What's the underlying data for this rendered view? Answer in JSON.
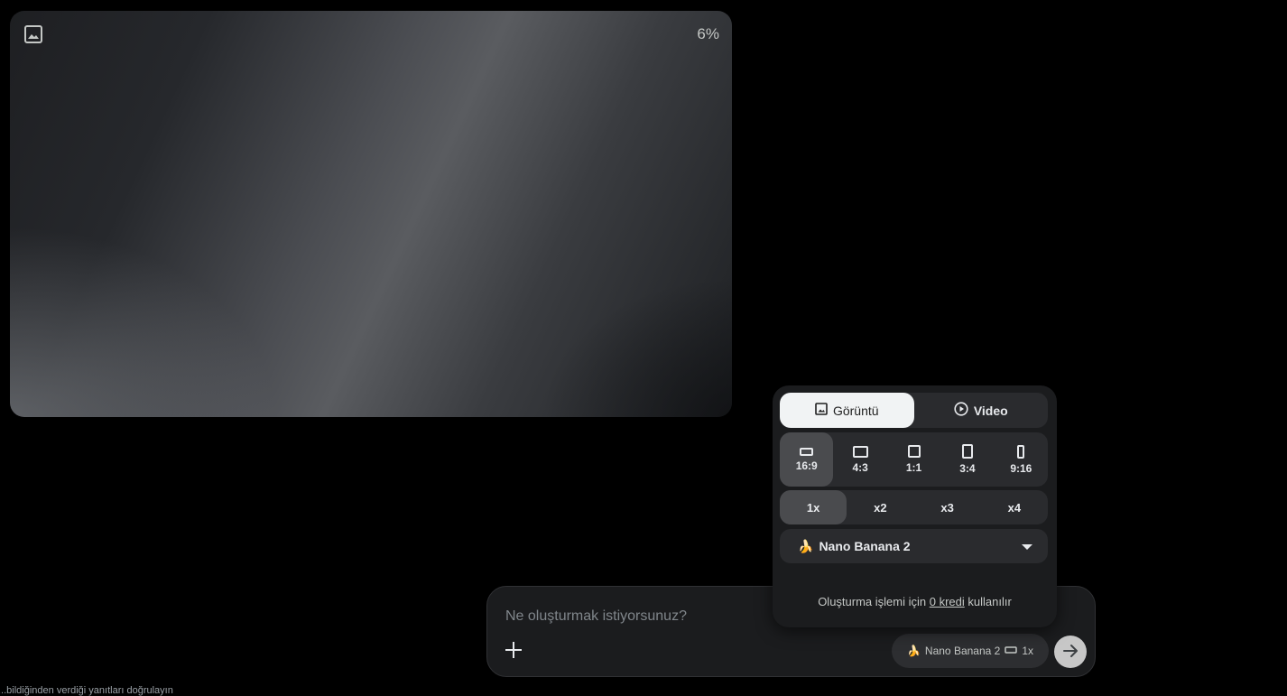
{
  "preview": {
    "icon": "image-icon",
    "progress": "6%"
  },
  "popover": {
    "modes": [
      {
        "label": "Görüntü",
        "icon": "image-icon",
        "active": true
      },
      {
        "label": "Video",
        "icon": "play-circle-icon",
        "active": false
      }
    ],
    "aspect_ratios": [
      {
        "label": "16:9",
        "active": true
      },
      {
        "label": "4:3",
        "active": false
      },
      {
        "label": "1:1",
        "active": false
      },
      {
        "label": "3:4",
        "active": false
      },
      {
        "label": "9:16",
        "active": false
      }
    ],
    "counts": [
      {
        "label": "1x",
        "active": true
      },
      {
        "label": "x2",
        "active": false
      },
      {
        "label": "x3",
        "active": false
      },
      {
        "label": "x4",
        "active": false
      }
    ],
    "model": {
      "emoji": "🍌",
      "label": "Nano Banana 2",
      "icon": "caret-down-icon"
    },
    "credit": {
      "prefix": "Oluşturma işlemi için",
      "link": "0 kredi",
      "suffix": "kullanılır"
    }
  },
  "composer": {
    "placeholder": "Ne oluşturmak istiyorsunuz?",
    "value": "",
    "add_icon": "plus-icon",
    "chip": {
      "emoji": "🍌",
      "model": "Nano Banana 2",
      "ratio_icon": "aspect-16-9-icon",
      "count": "1x"
    },
    "send_icon": "arrow-right-icon"
  },
  "footer": {
    "disclaimer": "...bildiğinden verdiği yanıtları doğrulayın"
  },
  "colors": {
    "background": "#000000",
    "panel": "#1b1c1e",
    "segment": "#2a2b2e",
    "segment_active": "#4a4b4e",
    "toggle_active": "#f1f3f4",
    "send": "#c7c7c7"
  }
}
